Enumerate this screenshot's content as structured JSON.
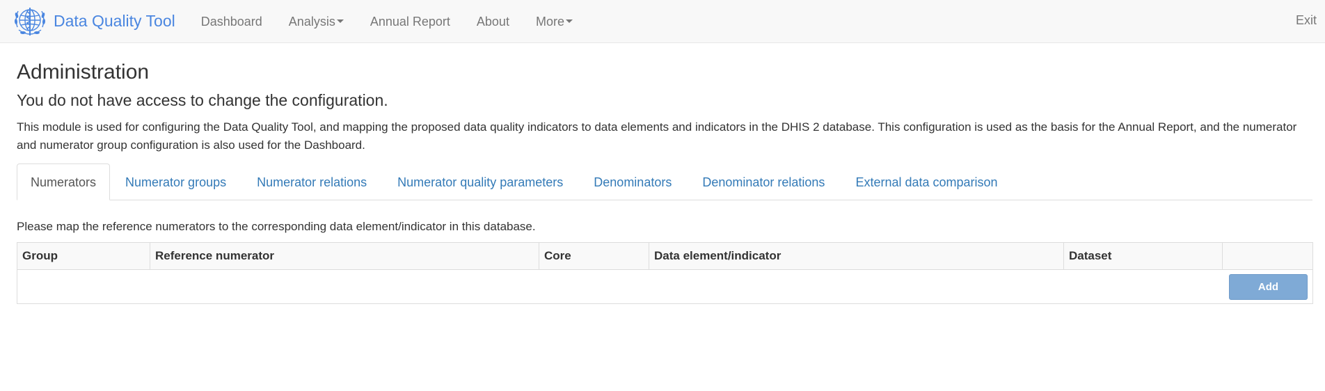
{
  "navbar": {
    "brand": "Data Quality Tool",
    "items": [
      {
        "label": "Dashboard",
        "caret": false
      },
      {
        "label": "Analysis",
        "caret": true
      },
      {
        "label": "Annual Report",
        "caret": false
      },
      {
        "label": "About",
        "caret": false
      },
      {
        "label": "More",
        "caret": true
      }
    ],
    "exit": "Exit"
  },
  "page": {
    "title": "Administration",
    "subtitle": "You do not have access to change the configuration.",
    "description": "This module is used for configuring the Data Quality Tool, and mapping the proposed data quality indicators to data elements and indicators in the DHIS 2 database. This configuration is used as the basis for the Annual Report, and the numerator and numerator group configuration is also used for the Dashboard."
  },
  "tabs": [
    {
      "label": "Numerators",
      "active": true
    },
    {
      "label": "Numerator groups",
      "active": false
    },
    {
      "label": "Numerator relations",
      "active": false
    },
    {
      "label": "Numerator quality parameters",
      "active": false
    },
    {
      "label": "Denominators",
      "active": false
    },
    {
      "label": "Denominator relations",
      "active": false
    },
    {
      "label": "External data comparison",
      "active": false
    }
  ],
  "numerators": {
    "instruction": "Please map the reference numerators to the corresponding data element/indicator in this database.",
    "columns": [
      "Group",
      "Reference numerator",
      "Core",
      "Data element/indicator",
      "Dataset",
      ""
    ],
    "add_label": "Add"
  },
  "colors": {
    "brand": "#4a86e0",
    "link": "#337ab7",
    "add_button": "#7faad6"
  },
  "icons": {
    "logo": "who-emblem-icon",
    "caret": "caret-down-icon"
  }
}
